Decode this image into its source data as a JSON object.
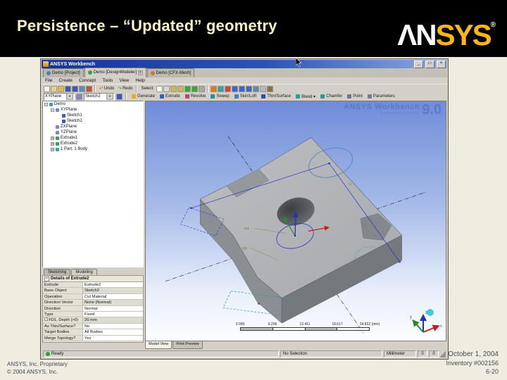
{
  "ui": {
    "dropdown_arrow": "▼",
    "scroll_left": "◄",
    "scroll_right": "►"
  },
  "slide": {
    "title": "Persistence – “Updated” geometry",
    "logo": {
      "an": "ΛN",
      "sys": "SYS",
      "reg": "®"
    },
    "footer_left": {
      "line1": "ANSYS, Inc. Proprietary",
      "line2": "© 2004 ANSYS, Inc."
    },
    "footer_right": {
      "date": "October 1, 2004",
      "inventory": "Inventory #002156",
      "page": "6-20"
    }
  },
  "window": {
    "title": "ANSYS Workbench",
    "controls": {
      "min": "_",
      "max": "□",
      "close": "×"
    },
    "tabs": [
      {
        "name": "tab-demo-project",
        "label": "Demo [Project]",
        "icon_color": "#4a7ac8"
      },
      {
        "name": "tab-demo-designmodeler",
        "label": "Demo [DesignModeler]",
        "icon_color": "#3aa048",
        "close": "x",
        "active": true
      },
      {
        "name": "tab-demo-cfx-mesh",
        "label": "Demo [CFX-Mesh]",
        "icon_color": "#c87830"
      }
    ],
    "menu": [
      {
        "name": "menu-file",
        "label": "File"
      },
      {
        "name": "menu-create",
        "label": "Create"
      },
      {
        "name": "menu-concept",
        "label": "Concept"
      },
      {
        "name": "menu-tools",
        "label": "Tools"
      },
      {
        "name": "menu-view",
        "label": "View"
      },
      {
        "name": "menu-help",
        "label": "Help"
      }
    ],
    "toolbar1": {
      "undo_glyph": "↶",
      "undo_label": "Undo",
      "redo_glyph": "↷",
      "redo_label": "Redo",
      "select_label": "Select:",
      "file_icons": [
        {
          "name": "new-icon",
          "color": "#f5f5ea"
        },
        {
          "name": "open-icon",
          "color": "#e8d088"
        },
        {
          "name": "import-icon",
          "color": "#e8b84a"
        },
        {
          "name": "save-icon",
          "color": "#3a58b8"
        },
        {
          "name": "save-as-icon",
          "color": "#3a58b8"
        },
        {
          "name": "export-icon",
          "color": "#5a88c8"
        },
        {
          "name": "settings-icon",
          "color": "#b85838"
        }
      ],
      "select_icons": [
        {
          "name": "select-cursor-icon",
          "color": "#f8f8f8"
        },
        {
          "name": "select-box-icon",
          "color": "#d8d8e0"
        },
        {
          "name": "vertex-filter-icon",
          "color": "#c8b858"
        },
        {
          "name": "edge-filter-icon",
          "color": "#c8b858"
        },
        {
          "name": "face-filter-icon",
          "color": "#38a838"
        },
        {
          "name": "body-filter-icon",
          "color": "#38a838"
        },
        {
          "name": "extend-selection-icon",
          "color": "#a8a8a8"
        }
      ],
      "view_icons": [
        {
          "name": "rotate-icon",
          "color": "#e07820"
        },
        {
          "name": "pan-icon",
          "color": "#28a8a8"
        },
        {
          "name": "zoom-icon",
          "color": "#c84848"
        },
        {
          "name": "zoom-in-icon",
          "color": "#3868c8"
        },
        {
          "name": "zoom-out-icon",
          "color": "#3868c8"
        },
        {
          "name": "zoom-box-icon",
          "color": "#3868c8"
        },
        {
          "name": "look-at-icon",
          "color": "#6888a8"
        },
        {
          "name": "previous-view-icon",
          "color": "#b8b8c0"
        },
        {
          "name": "isometric-icon",
          "color": "#887048"
        }
      ]
    },
    "toolbar2": {
      "plane_value": "XYPlane",
      "sketch_value": "Sketch2",
      "buttons": [
        {
          "name": "generate-button",
          "label": "Generate",
          "color": "#e8b020"
        },
        {
          "name": "extrude-button",
          "label": "Extrude",
          "color": "#3060c0"
        },
        {
          "name": "revolve-button",
          "label": "Revolve",
          "color": "#b04878"
        },
        {
          "name": "sweep-button",
          "label": "Sweep",
          "color": "#2090a0"
        },
        {
          "name": "skin-loft-button",
          "label": "Skin/Loft",
          "color": "#4878c8"
        },
        {
          "name": "thin-surface-button",
          "label": "Thin/Surface",
          "color": "#2850a8"
        },
        {
          "name": "blend-button",
          "label": "Blend ▾",
          "color": "#20a090"
        },
        {
          "name": "chamfer-button",
          "label": "Chamfer",
          "color": "#20a090"
        },
        {
          "name": "point-button",
          "label": "Point",
          "color": "#687888"
        },
        {
          "name": "parameters-button",
          "label": "Parameters",
          "color": "#708090"
        }
      ]
    },
    "tree": {
      "items": [
        {
          "label": "Demo",
          "expander": "−",
          "icon_color": "#38a0a0",
          "level": 0
        },
        {
          "label": "XYPlane",
          "expander": "−",
          "icon_color": "#7888c8",
          "level": 1
        },
        {
          "label": "Sketch1",
          "icon_color": "#3858c8",
          "level": 2
        },
        {
          "label": "Sketch2",
          "icon_color": "#3858c8",
          "level": 2
        },
        {
          "label": "ZXPlane",
          "icon_color": "#7888c8",
          "level": 1
        },
        {
          "label": "YZPlane",
          "icon_color": "#7888c8",
          "level": 1
        },
        {
          "label": "Extrude1",
          "expander": "+",
          "icon_color": "#38a058",
          "level": 1
        },
        {
          "label": "Extrude2",
          "expander": "+",
          "icon_color": "#38a058",
          "level": 1
        },
        {
          "label": "1 Part, 1 Body",
          "expander": "+",
          "icon_color": "#28a8a8",
          "level": 1
        }
      ]
    },
    "panel_tabs": {
      "sketching": "Sketching",
      "modeling": "Modeling"
    },
    "details": {
      "collapse": "−",
      "title": "Details of Extrude2",
      "rows": [
        {
          "label": "Extrude",
          "value": "Extrude2"
        },
        {
          "label": "Base Object",
          "value": "Sketch2",
          "cls": "shade"
        },
        {
          "label": "Operation",
          "value": "Cut Material"
        },
        {
          "label": "Direction Vector",
          "value": "None (Normal)",
          "cls": "shade"
        },
        {
          "label": "Direction",
          "value": "Normal"
        },
        {
          "label": "Type",
          "value": "Fixed"
        },
        {
          "prefix": "☐",
          "label": "FD1, Depth (>0)",
          "value": "20 mm",
          "cls": "shade"
        },
        {
          "label": "As Thin/Surface?",
          "value": "No"
        },
        {
          "label": "Target Bodies",
          "value": "All Bodies"
        },
        {
          "label": "Merge Topology?",
          "value": "Yes"
        }
      ]
    },
    "viewport": {
      "watermark": {
        "line1": "ANSYS Workbench",
        "version": "9.0",
        "line2": "Evaluation Version"
      },
      "ruler": [
        "0.000",
        "6.206",
        "12.411",
        "18.617",
        "24.822 (mm)"
      ],
      "annotations": {
        "h": "H4",
        "v": "V5",
        "u": "U"
      },
      "triad": {
        "x": "x",
        "y": "y",
        "z": "z"
      }
    },
    "view_tabs": [
      {
        "label": "Model View",
        "active": true
      },
      {
        "label": "Print Preview"
      }
    ],
    "statusbar": {
      "ready": "Ready",
      "selection": "No Selection",
      "units": "Millimeter",
      "field1": "0",
      "field2": "0"
    }
  }
}
